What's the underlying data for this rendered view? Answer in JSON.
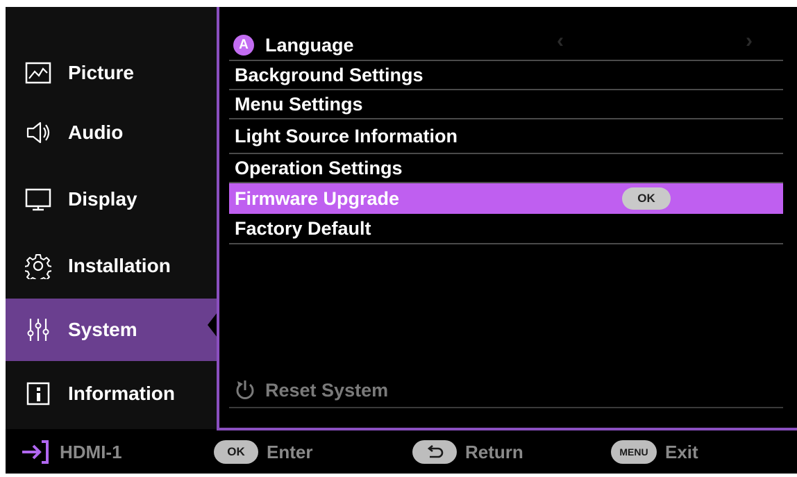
{
  "sidebar": {
    "items": [
      {
        "label": "Picture",
        "icon": "picture-icon"
      },
      {
        "label": "Audio",
        "icon": "speaker-icon"
      },
      {
        "label": "Display",
        "icon": "monitor-icon"
      },
      {
        "label": "Installation",
        "icon": "gear-icon"
      },
      {
        "label": "System",
        "icon": "sliders-icon",
        "selected": true
      },
      {
        "label": "Information",
        "icon": "info-icon"
      }
    ]
  },
  "menu": {
    "language": {
      "label": "Language",
      "icon_letter": "A"
    },
    "items": [
      {
        "label": "Background Settings"
      },
      {
        "label": "Menu Settings"
      },
      {
        "label": "Light Source Information"
      },
      {
        "label": "Operation Settings"
      },
      {
        "label": "Firmware Upgrade",
        "highlighted": true,
        "action": "OK"
      },
      {
        "label": "Factory Default"
      }
    ],
    "reset": {
      "label": "Reset System",
      "disabled": true
    }
  },
  "bottom_bar": {
    "source": "HDMI-1",
    "enter": {
      "key": "OK",
      "label": "Enter"
    },
    "return": {
      "label": "Return"
    },
    "exit": {
      "key": "MENU",
      "label": "Exit"
    }
  },
  "colors": {
    "accent": "#bf5ff0",
    "sidebar_selected": "#6a3f8f",
    "border": "#8a4fbf",
    "input_icon": "#b067f0"
  }
}
